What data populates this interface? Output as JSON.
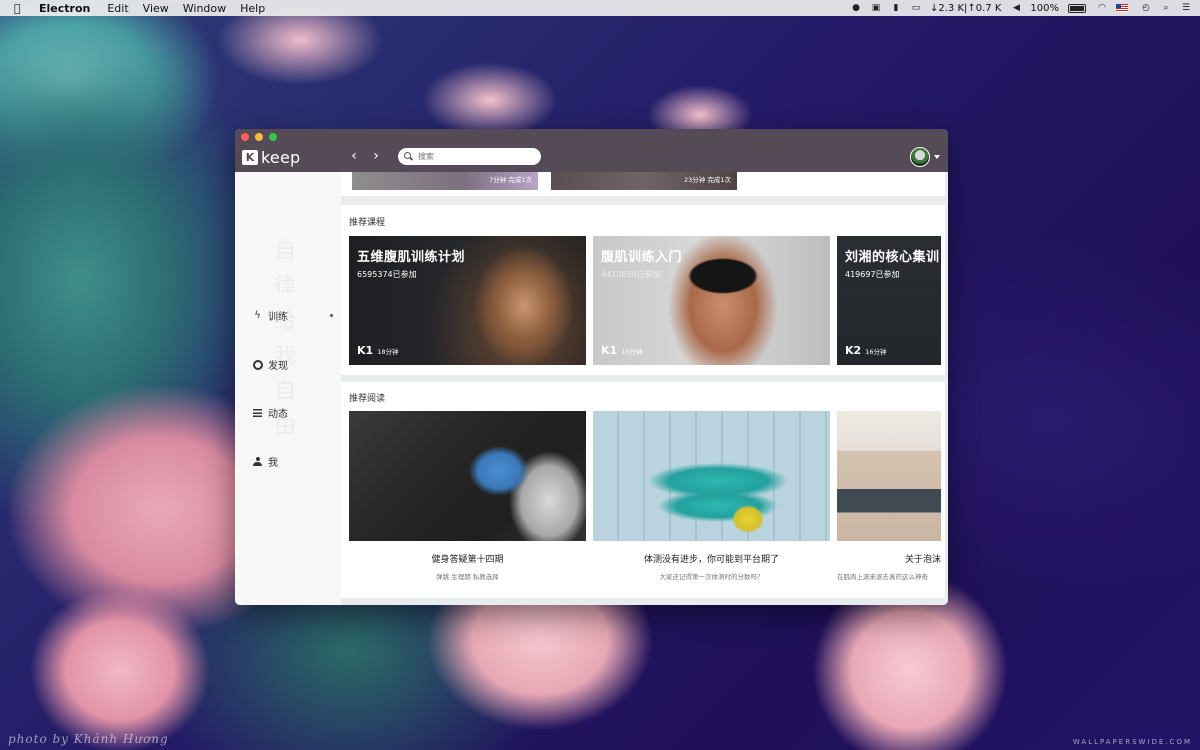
{
  "menubar": {
    "apple": "",
    "app_name": "Electron",
    "menus": [
      "Edit",
      "View",
      "Window",
      "Help"
    ],
    "network": "↓2.3 K|↑0.7 K",
    "battery": "100%"
  },
  "window": {
    "logo_badge": "K",
    "logo_text": "keep",
    "nav_back": "‹",
    "nav_forward": "›",
    "search_placeholder": "搜索"
  },
  "sidebar": {
    "decoration": "自律给我自由",
    "items": [
      {
        "label": "训练",
        "icon": "bolt-icon",
        "active": true
      },
      {
        "label": "发现",
        "icon": "ring-icon"
      },
      {
        "label": "动态",
        "icon": "list-icon"
      },
      {
        "label": "我",
        "icon": "person-icon"
      }
    ]
  },
  "top_strip": [
    {
      "text": "7分钟  完成1次"
    },
    {
      "text": "23分钟  完成1次"
    }
  ],
  "courses": {
    "title": "推荐课程",
    "items": [
      {
        "title": "五维腹肌训练计划",
        "participants": "6595374已参加",
        "level": "K1",
        "duration": "18分钟"
      },
      {
        "title": "腹肌训练入门",
        "participants": "4410859已参加",
        "level": "K1",
        "duration": "16分钟"
      },
      {
        "title": "刘湘的核心集训",
        "participants": "419697已参加",
        "level": "K2",
        "duration": "16分钟"
      }
    ]
  },
  "readings": {
    "title": "推荐阅读",
    "items": [
      {
        "title": "健身答疑第十四期",
        "desc": "弹跳 生理期 私教选择"
      },
      {
        "title": "体测没有进步，你可能到平台期了",
        "desc": "大家还记得第一次体测时的分数吗？"
      },
      {
        "title": "关于泡沫",
        "desc": "在肌肉上滚来滚去真的这么神奇"
      }
    ]
  },
  "watermark": {
    "left": "photo by Khánh Hương",
    "right": "WALLPAPERSWIDE.COM"
  },
  "colors": {
    "titlebar": "#554b57",
    "accent": "#554b57"
  }
}
